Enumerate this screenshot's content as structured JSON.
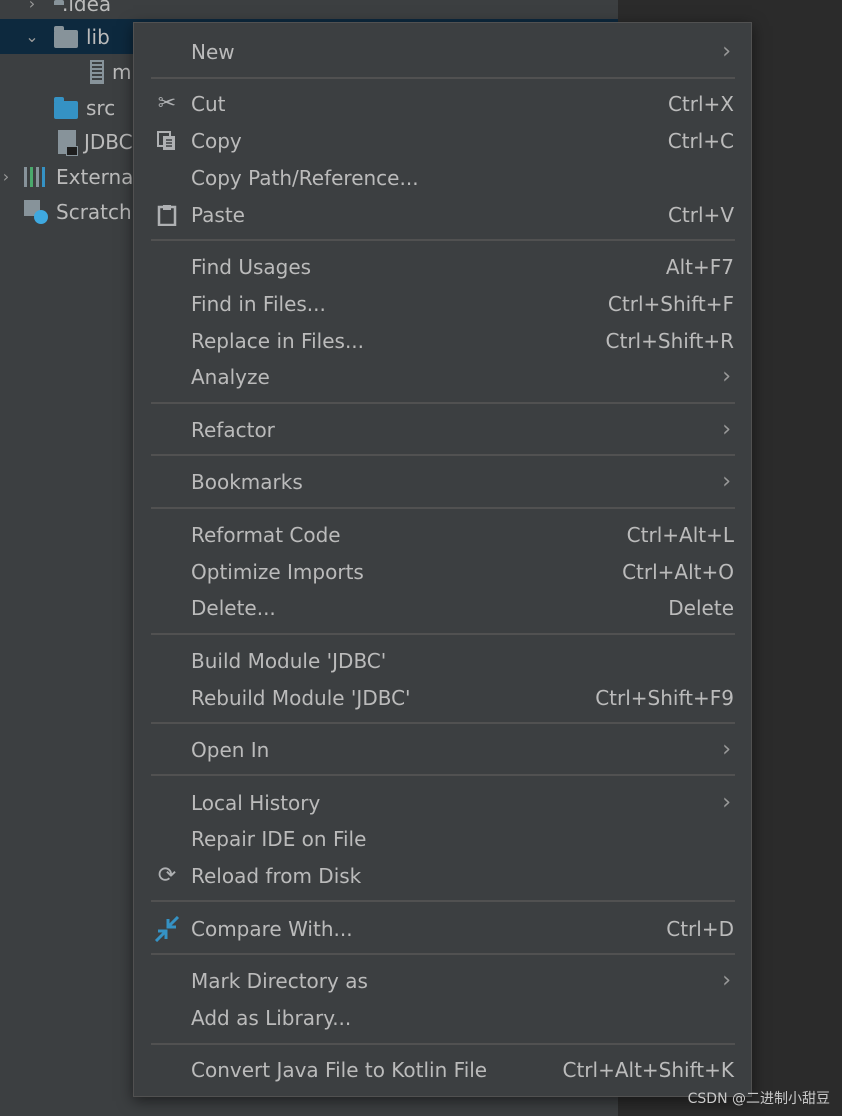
{
  "project_tree": {
    "rows": [
      {
        "label": ".idea"
      },
      {
        "label": "lib"
      },
      {
        "label": "m"
      },
      {
        "label": "src"
      },
      {
        "label": "JDBC"
      },
      {
        "label": "Externa"
      },
      {
        "label": "Scratch"
      }
    ]
  },
  "menu": {
    "items": [
      {
        "label": "New",
        "shortcut": "",
        "submenu": true
      },
      {
        "label": "Cut",
        "shortcut": "Ctrl+X",
        "icon": "scissors-icon"
      },
      {
        "label": "Copy",
        "shortcut": "Ctrl+C",
        "icon": "copy-icon"
      },
      {
        "label": "Copy Path/Reference...",
        "shortcut": ""
      },
      {
        "label": "Paste",
        "shortcut": "Ctrl+V",
        "icon": "clipboard-icon"
      },
      {
        "label": "Find Usages",
        "shortcut": "Alt+F7"
      },
      {
        "label": "Find in Files...",
        "shortcut": "Ctrl+Shift+F"
      },
      {
        "label": "Replace in Files...",
        "shortcut": "Ctrl+Shift+R"
      },
      {
        "label": "Analyze",
        "shortcut": "",
        "submenu": true
      },
      {
        "label": "Refactor",
        "shortcut": "",
        "submenu": true
      },
      {
        "label": "Bookmarks",
        "shortcut": "",
        "submenu": true
      },
      {
        "label": "Reformat Code",
        "shortcut": "Ctrl+Alt+L"
      },
      {
        "label": "Optimize Imports",
        "shortcut": "Ctrl+Alt+O"
      },
      {
        "label": "Delete...",
        "shortcut": "Delete"
      },
      {
        "label": "Build Module 'JDBC'",
        "shortcut": ""
      },
      {
        "label": "Rebuild Module 'JDBC'",
        "shortcut": "Ctrl+Shift+F9"
      },
      {
        "label": "Open In",
        "shortcut": "",
        "submenu": true
      },
      {
        "label": "Local History",
        "shortcut": "",
        "submenu": true
      },
      {
        "label": "Repair IDE on File",
        "shortcut": ""
      },
      {
        "label": "Reload from Disk",
        "shortcut": "",
        "icon": "reload-icon"
      },
      {
        "label": "Compare With...",
        "shortcut": "Ctrl+D",
        "icon": "compare-icon"
      },
      {
        "label": "Mark Directory as",
        "shortcut": "",
        "submenu": true
      },
      {
        "label": "Add as Library...",
        "shortcut": ""
      },
      {
        "label": "Convert Java File to Kotlin File",
        "shortcut": "Ctrl+Alt+Shift+K"
      }
    ],
    "submenu_glyph": "›"
  },
  "watermark": "CSDN @二进制小甜豆",
  "colors": {
    "menu_bg": "#3c3f41",
    "separator": "#515151",
    "text": "#bbbbbb",
    "selection": "#0d293e",
    "accent_blue": "#3592c4"
  }
}
